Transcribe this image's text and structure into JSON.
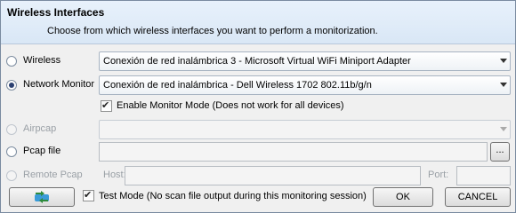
{
  "header": {
    "title": "Wireless Interfaces",
    "subtitle": "Choose from which wireless interfaces you want to perform a monitorization."
  },
  "options": {
    "wireless": {
      "label": "Wireless",
      "value": "Conexión de red inalámbrica 3 -  Microsoft Virtual WiFi Miniport Adapter",
      "checked": false
    },
    "network_monitor": {
      "label": "Network Monitor",
      "value": "Conexión de red inalámbrica -  Dell Wireless 1702 802.11b/g/n",
      "checked": true
    },
    "enable_monitor_mode": {
      "label": "Enable Monitor Mode (Does not work for all devices)",
      "checked": true
    },
    "airpcap": {
      "label": "Airpcap",
      "value": "",
      "enabled": false
    },
    "pcap_file": {
      "label": "Pcap file",
      "value": "",
      "browse_label": "..."
    },
    "remote_pcap": {
      "label": "Remote Pcap",
      "host_label": "Host:",
      "port_label": "Port:",
      "enabled": false
    }
  },
  "footer": {
    "test_mode_label": "Test Mode (No scan file output during this monitoring session)",
    "test_mode_checked": true,
    "ok_label": "OK",
    "cancel_label": "CANCEL",
    "refresh_icon": "refresh-icon"
  },
  "colors": {
    "header_bg": "#dfeaf7",
    "radio_dot": "#2a3f70",
    "disabled_text": "#9aa0a6"
  }
}
